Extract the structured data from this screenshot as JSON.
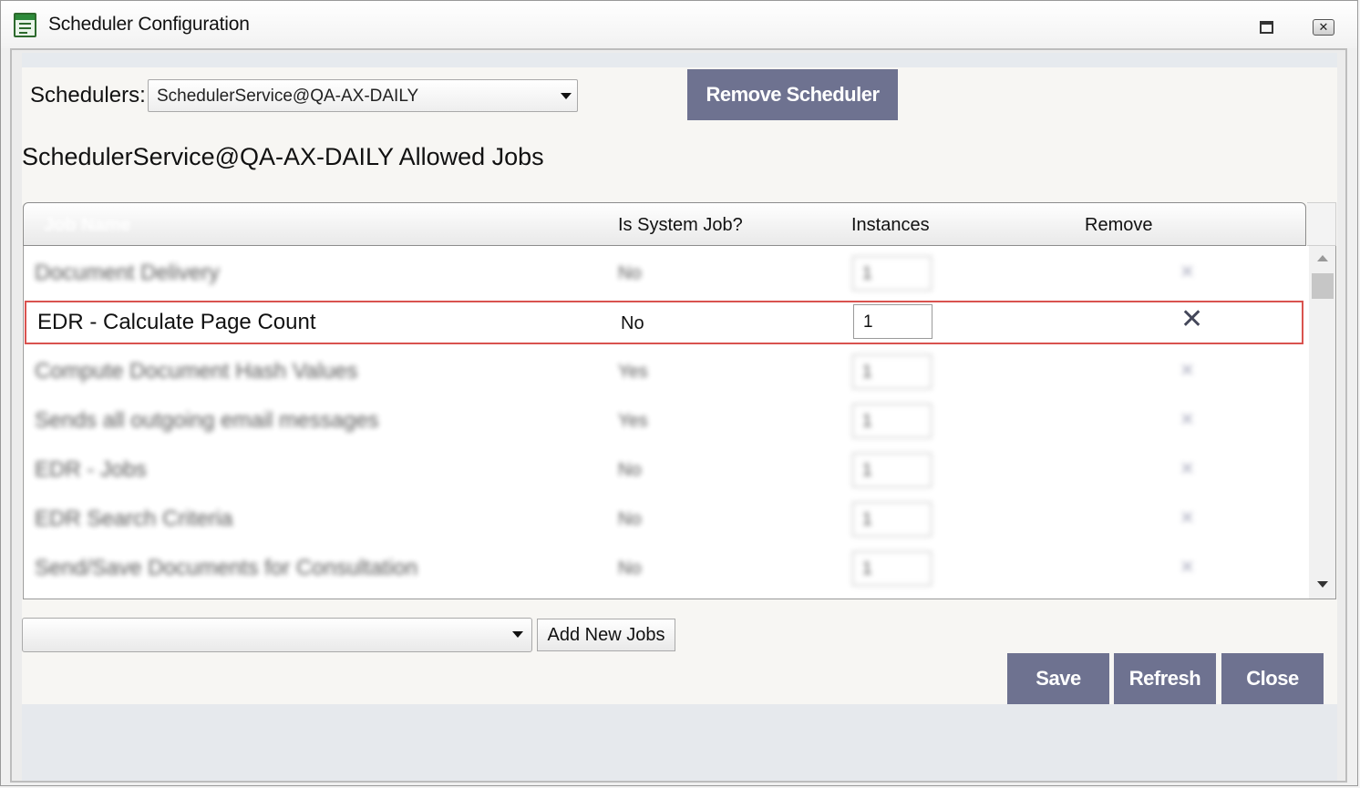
{
  "window": {
    "title": "Scheduler Configuration",
    "icons": {
      "app": "scheduler-app-icon",
      "maximize": "maximize-icon",
      "close": "close-icon"
    },
    "close_glyph": "✕"
  },
  "scheduler": {
    "label": "Schedulers:",
    "selected": "SchedulerService@QA-AX-DAILY",
    "remove_button": "Remove Scheduler"
  },
  "jobs": {
    "heading": "SchedulerService@QA-AX-DAILY Allowed Jobs",
    "columns": [
      "Job Name",
      "Is System Job?",
      "Instances",
      "Remove"
    ],
    "rows": [
      {
        "name": "Document Delivery",
        "system": "No",
        "instances": "1",
        "blurred": true
      },
      {
        "name": "EDR - Calculate Page Count",
        "system": "No",
        "instances": "1",
        "blurred": false,
        "selected": true
      },
      {
        "name": "Compute Document Hash Values",
        "system": "Yes",
        "instances": "1",
        "blurred": true
      },
      {
        "name": "Sends all outgoing email messages",
        "system": "Yes",
        "instances": "1",
        "blurred": true
      },
      {
        "name": "EDR - Jobs",
        "system": "No",
        "instances": "1",
        "blurred": true
      },
      {
        "name": "EDR Search Criteria",
        "system": "No",
        "instances": "1",
        "blurred": true
      },
      {
        "name": "Send/Save Documents for Consultation",
        "system": "No",
        "instances": "1",
        "blurred": true
      }
    ],
    "remove_glyph": "✕"
  },
  "footer": {
    "job_select_value": "",
    "add_new_jobs": "Add New Jobs",
    "save": "Save",
    "refresh": "Refresh",
    "close": "Close"
  },
  "colors": {
    "accent_button": "#6e7290",
    "selected_row_border": "#d9534f",
    "panel_background": "#f7f6f3"
  }
}
